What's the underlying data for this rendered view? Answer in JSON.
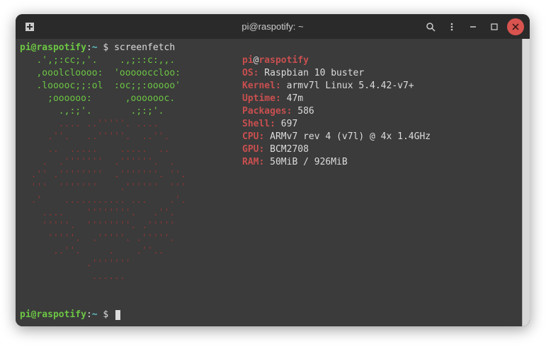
{
  "titlebar": {
    "title": "pi@raspotify: ~"
  },
  "prompt": {
    "user": "pi",
    "at": "@",
    "host": "raspotify",
    "colon": ":",
    "path": "~",
    "dollar": " $ ",
    "command": "screenfetch"
  },
  "ascii": {
    "l1": "   .',;:cc;,'.    .,;::c:,,.   ",
    "l2": "   ,ooolcloooo:  'oooooccloo:  ",
    "l3": "   .looooc;;:ol  :oc;;:ooooo'  ",
    "l4": "     ;oooooo:      ,ooooooc.   ",
    "l5": "       .,:;'.       .;:;'.     ",
    "r1": "       .... ..'''''. ....      ",
    "r2": "     .''.   ..'''''.  ..''.    ",
    "r3": "     ..  .....    .....  ..    ",
    "r4": "    .  .'''''''  .''''''.  .   ",
    "r5": "  .'' .''''''''  .'''''''. ''. ",
    "r6": "  '''  '''''''    .''''''  ''' ",
    "r7": "  .'    ........... ...    .'. ",
    "r8": "    ....    ''''''''.   .''.   ",
    "r9": "    '''''.  ''''''''. .'''''   ",
    "r10": "     '''''.  .'''''. .'''''.   ",
    "r11": "      ..''.     .    .''..     ",
    "r12": "            .'''''''           ",
    "r13": "             ......            "
  },
  "info": {
    "user": "pi",
    "at": "@",
    "host": "raspotify",
    "os_label": "OS:",
    "os_value": " Raspbian 10 buster",
    "kernel_label": "Kernel:",
    "kernel_value": " armv7l Linux 5.4.42-v7+",
    "uptime_label": "Uptime:",
    "uptime_value": " 47m",
    "packages_label": "Packages:",
    "packages_value": " 586",
    "shell_label": "Shell:",
    "shell_value": " 697",
    "cpu_label": "CPU:",
    "cpu_value": " ARMv7 rev 4 (v7l) @ 4x 1.4GHz",
    "gpu_label": "GPU:",
    "gpu_value": " BCM2708",
    "ram_label": "RAM:",
    "ram_value": " 50MiB / 926MiB"
  }
}
